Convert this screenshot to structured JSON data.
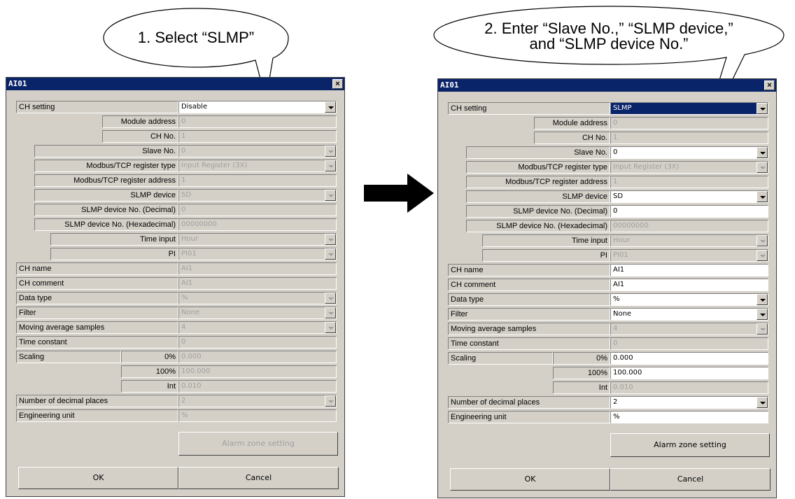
{
  "callouts": {
    "left": "1. Select “SLMP”",
    "right_line1": "2. Enter “Slave No.,” “SLMP device,”",
    "right_line2": "and “SLMP device No.”"
  },
  "labels": {
    "title": "AI01",
    "close": "×",
    "ch_setting": "CH setting",
    "module_address": "Module address",
    "ch_no": "CH No.",
    "slave_no": "Slave No.",
    "modbus_type": "Modbus/TCP register type",
    "modbus_address": "Modbus/TCP register address",
    "slmp_device": "SLMP device",
    "slmp_dec": "SLMP device No. (Decimal)",
    "slmp_hex": "SLMP device No. (Hexadecimal)",
    "time_input": "Time input",
    "pi": "PI",
    "ch_name": "CH name",
    "ch_comment": "CH comment",
    "data_type": "Data type",
    "filter": "Filter",
    "moving_avg": "Moving average samples",
    "time_constant": "Time constant",
    "scaling": "Scaling",
    "scale_0": "0%",
    "scale_100": "100%",
    "scale_int": "Int",
    "decimals": "Number of decimal places",
    "eng_unit": "Engineering unit",
    "alarm_btn": "Alarm zone setting",
    "ok": "OK",
    "cancel": "Cancel"
  },
  "left": {
    "ch_setting": "Disable",
    "module_address": "0",
    "ch_no": "1",
    "slave_no": "0",
    "modbus_type": "Input Register (3X)",
    "modbus_address": "1",
    "slmp_device": "SD",
    "slmp_dec": "0",
    "slmp_hex": "00000000",
    "time_input": "Hour",
    "pi": "PI01",
    "ch_name": "AI1",
    "ch_comment": "AI1",
    "data_type": "%",
    "filter": "None",
    "moving_avg": "4",
    "time_constant": "0",
    "scale_0": "0.000",
    "scale_100": "100.000",
    "scale_int": "0.010",
    "decimals": "2",
    "eng_unit": "%"
  },
  "right": {
    "ch_setting": "SLMP",
    "module_address": "0",
    "ch_no": "1",
    "slave_no": "0",
    "modbus_type": "Input Register (3X)",
    "modbus_address": "1",
    "slmp_device": "SD",
    "slmp_dec": "0",
    "slmp_hex": "00000000",
    "time_input": "Hour",
    "pi": "PI01",
    "ch_name": "AI1",
    "ch_comment": "AI1",
    "data_type": "%",
    "filter": "None",
    "moving_avg": "4",
    "time_constant": "0",
    "scale_0": "0.000",
    "scale_100": "100.000",
    "scale_int": "0.010",
    "decimals": "2",
    "eng_unit": "%"
  },
  "colors": {
    "titlebar": "#0a246a",
    "dialog_bg": "#d4d0c8",
    "disabled_text": "#a0a0a0"
  }
}
